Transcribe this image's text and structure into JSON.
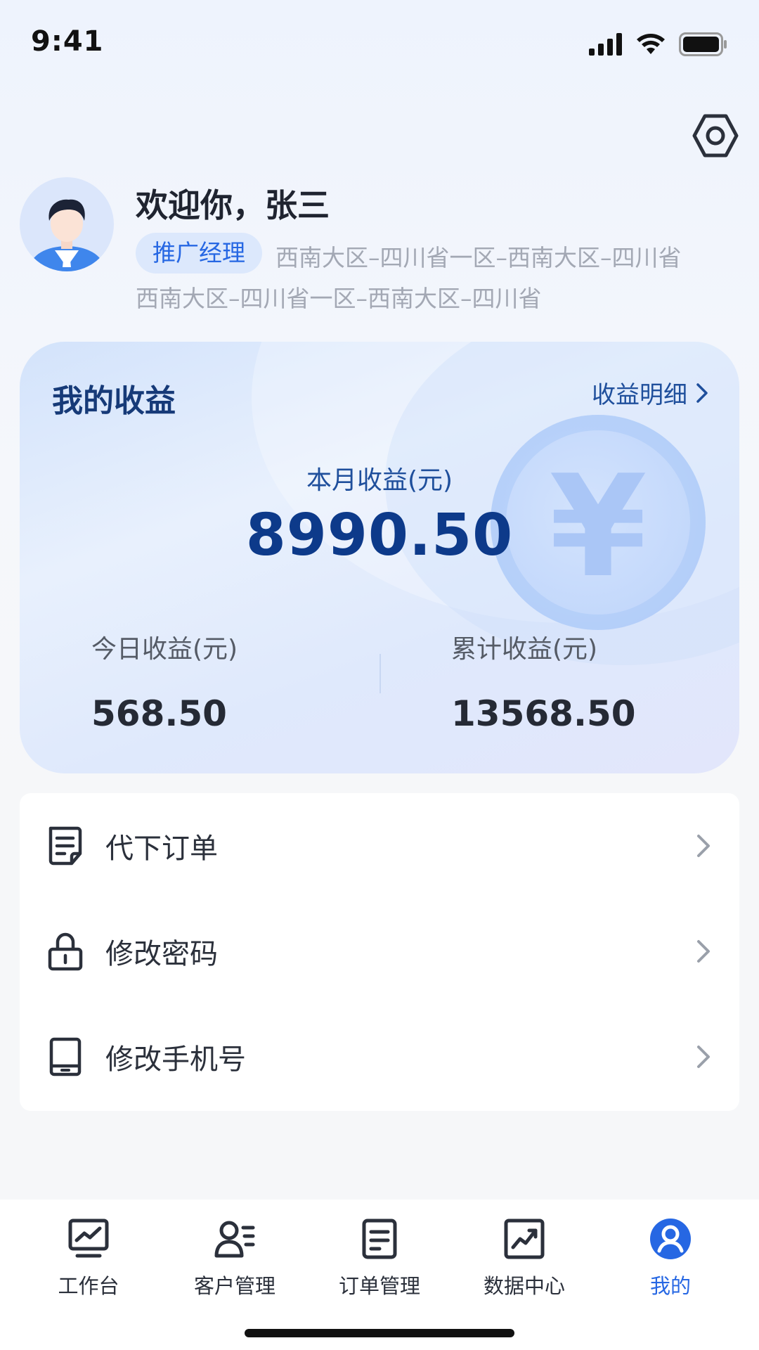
{
  "status_bar": {
    "time": "9:41"
  },
  "profile": {
    "welcome": "欢迎你，张三",
    "role": "推广经理",
    "region_line1": "西南大区–四川省一区–西南大区–四川省",
    "region_line2": "西南大区–四川省一区–西南大区–四川省"
  },
  "earnings": {
    "title": "我的收益",
    "detail_link": "收益明细",
    "month_label": "本月收益(元)",
    "month_value": "8990.50",
    "today_label": "今日收益(元)",
    "today_value": "568.50",
    "total_label": "累计收益(元)",
    "total_value": "13568.50",
    "coin_symbol": "¥"
  },
  "menu": {
    "items": [
      {
        "label": "代下订单",
        "icon": "document-icon"
      },
      {
        "label": "修改密码",
        "icon": "lock-icon"
      },
      {
        "label": "修改手机号",
        "icon": "phone-icon"
      }
    ]
  },
  "tabs": [
    {
      "label": "工作台",
      "icon": "dashboard-icon"
    },
    {
      "label": "客户管理",
      "icon": "customers-icon"
    },
    {
      "label": "订单管理",
      "icon": "orders-icon"
    },
    {
      "label": "数据中心",
      "icon": "data-center-icon"
    },
    {
      "label": "我的",
      "icon": "profile-icon",
      "active": true
    }
  ],
  "colors": {
    "accent": "#2667e3",
    "card_title": "#163a78",
    "text_primary": "#2b303b",
    "text_muted": "#a3a8b4"
  }
}
